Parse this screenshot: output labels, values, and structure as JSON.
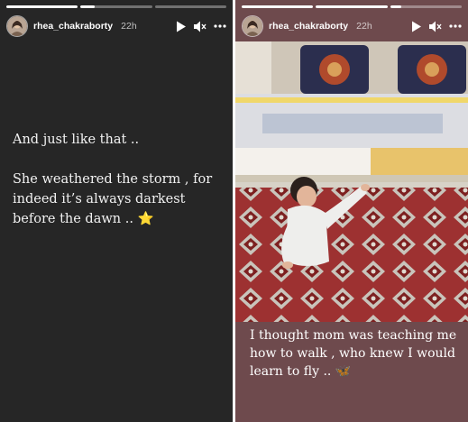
{
  "stories": [
    {
      "username": "rhea_chakraborty",
      "time": "22h",
      "progress": [
        1,
        0.2,
        0
      ],
      "text_lines": [
        "And just like that ..",
        "She weathered the storm , for indeed it’s always darkest before the dawn .. ⭐"
      ]
    },
    {
      "username": "rhea_chakraborty",
      "time": "22h",
      "progress": [
        1,
        1,
        0.15
      ],
      "caption": "I thought mom was teaching me how to walk , who knew I would learn to fly .. 🦋"
    }
  ],
  "icons": {
    "play": "play-icon",
    "mute": "speaker-muted-icon",
    "more": "more-horizontal-icon"
  },
  "colors": {
    "panel1_bg": "#262626",
    "panel2_caption_bg": "#6e4a4d",
    "text": "#ffffff"
  }
}
